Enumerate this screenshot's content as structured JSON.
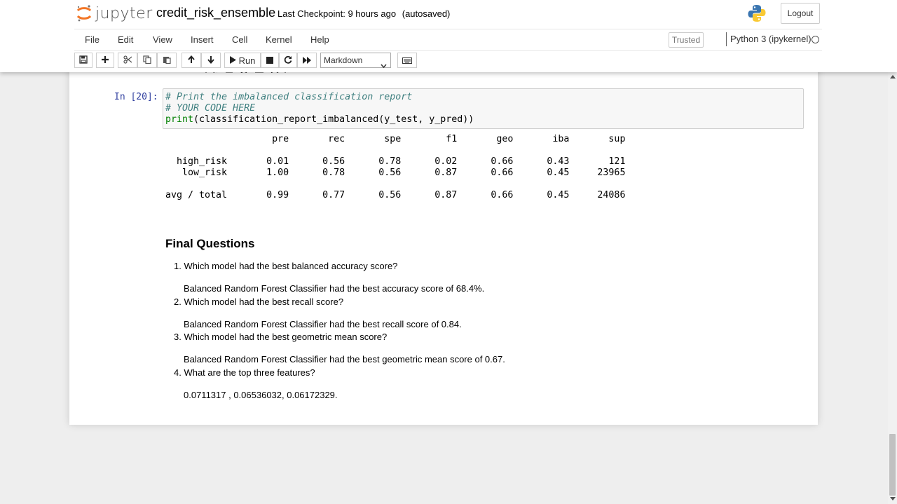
{
  "app": {
    "logo_text": "jupyter"
  },
  "notebook": {
    "name": "credit_risk_ensemble",
    "checkpoint": "Last Checkpoint: 9 hours ago",
    "autosave": "(autosaved)"
  },
  "header": {
    "logout_label": "Logout"
  },
  "menu": {
    "items": [
      "File",
      "Edit",
      "View",
      "Insert",
      "Cell",
      "Kernel",
      "Help"
    ],
    "trusted": "Trusted",
    "kernel": "Python 3 (ipykernel)"
  },
  "toolbar": {
    "run_label": "Run",
    "cell_type": "Markdown",
    "icons": [
      "save-icon",
      "plus-icon",
      "scissors-icon",
      "copy-icon",
      "paste-icon",
      "arrow-up-icon",
      "arrow-down-icon",
      "play-icon",
      "stop-icon",
      "restart-icon",
      "fast-forward-icon",
      "keyboard-icon"
    ]
  },
  "cell": {
    "prompt": "In [20]:",
    "code": {
      "line1": "# Print the imbalanced classification report",
      "line2": "# YOUR CODE HERE",
      "line3_builtin": "print",
      "line3_rest": "(classification_report_imbalanced(y_test, y_pred))"
    },
    "output": {
      "header": "                   pre       rec       spe        f1       geo       iba       sup",
      "row1": "  high_risk       0.01      0.56      0.78      0.02      0.66      0.43       121",
      "row2": "   low_risk       1.00      0.78      0.56      0.87      0.66      0.45     23965",
      "row3": "avg / total       0.99      0.77      0.56      0.87      0.66      0.45     24086"
    }
  },
  "markdown": {
    "heading": "Final Questions",
    "q1": "1. Which model had the best balanced accuracy score?",
    "a1": "Balanced Random Forest Classifier had the best accuracy score of 68.4%.",
    "q2": "2. Which model had the best recall score?",
    "a2": "Balanced Random Forest Classifier had the best recall score of 0.84.",
    "q3": "3. Which model had the best geometric mean score?",
    "a3": "Balanced Random Forest Classifier had the best geometric mean score of 0.67.",
    "q4": "4. What are the top three features?",
    "a4": "0.0711317 , 0.06536032, 0.06172329."
  },
  "colors": {
    "logo_orange": "#f37626",
    "prompt_blue": "#303f9f",
    "comment_teal": "#408080",
    "builtin_green": "#008000"
  }
}
